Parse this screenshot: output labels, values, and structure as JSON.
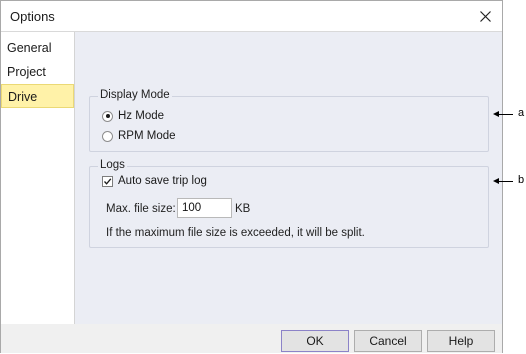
{
  "window": {
    "title": "Options"
  },
  "sidebar": {
    "items": [
      {
        "label": "General"
      },
      {
        "label": "Project"
      },
      {
        "label": "Drive"
      }
    ]
  },
  "display_mode": {
    "label": "Display Mode",
    "options": [
      {
        "label": "Hz Mode",
        "checked": true
      },
      {
        "label": "RPM Mode",
        "checked": false
      }
    ]
  },
  "logs": {
    "label": "Logs",
    "auto_save_label": "Auto save trip log",
    "auto_save_checked": true,
    "max_file_size_label": "Max. file size:",
    "max_file_size_value": "100",
    "unit": "KB",
    "note": "If the maximum file size is exceeded, it will be split."
  },
  "footer": {
    "ok": "OK",
    "cancel": "Cancel",
    "help": "Help"
  },
  "annotations": {
    "a": "a",
    "b": "b"
  }
}
